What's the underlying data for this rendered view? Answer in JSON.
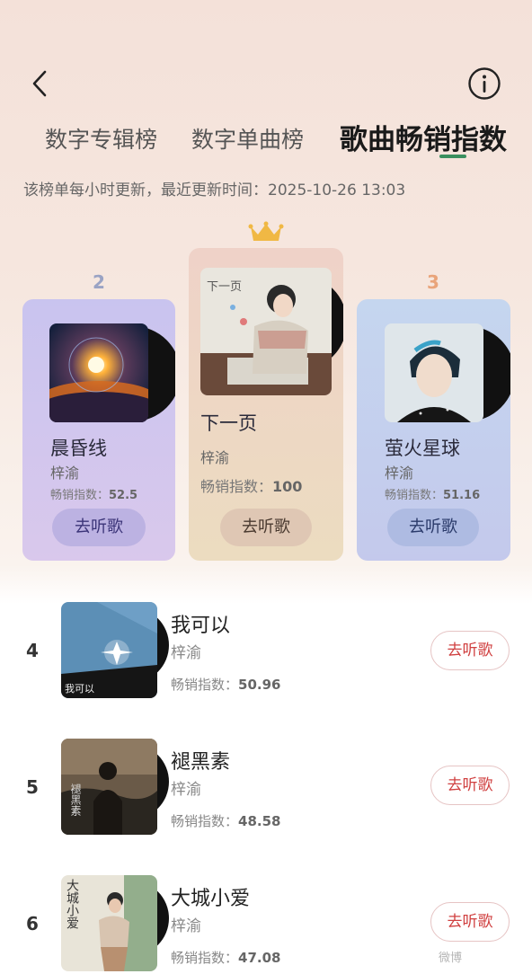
{
  "header": {
    "tabs": [
      "数字专辑榜",
      "数字单曲榜",
      "歌曲畅销指数"
    ],
    "active_tab": "歌曲畅销指数",
    "update_note": "该榜单每小时更新，最近更新时间：2025-10-26 13:03",
    "back_icon": "chevron-left-icon",
    "info_icon": "info-circle-icon"
  },
  "podium": {
    "crown_icon": "crown-icon",
    "first": {
      "rank": "1",
      "title": "下一页",
      "artist": "梓渝",
      "index_label": "畅销指数：",
      "index_value": "100",
      "button": "去听歌"
    },
    "second": {
      "rank": "2",
      "title": "晨昏线",
      "artist": "梓渝",
      "index_label": "畅销指数：",
      "index_value": "52.5",
      "button": "去听歌"
    },
    "third": {
      "rank": "3",
      "title": "萤火星球",
      "artist": "梓渝",
      "index_label": "畅销指数：",
      "index_value": "51.16",
      "button": "去听歌"
    }
  },
  "list": [
    {
      "rank": "4",
      "title": "我可以",
      "artist": "梓渝",
      "index_label": "畅销指数：",
      "index_value": "50.96",
      "button": "去听歌"
    },
    {
      "rank": "5",
      "title": "褪黑素",
      "artist": "梓渝",
      "index_label": "畅销指数：",
      "index_value": "48.58",
      "button": "去听歌"
    },
    {
      "rank": "6",
      "title": "大城小爱",
      "artist": "梓渝",
      "index_label": "畅销指数：",
      "index_value": "47.08",
      "button": "去听歌"
    }
  ],
  "cover_texts": {
    "first": "下一页",
    "list_4": "我可以",
    "list_5": "褪黑素",
    "list_6": "大城小爱"
  },
  "colors": {
    "accent_green": "#3a8f5f",
    "button_red": "#d04040",
    "rank2": "#9aa3c4",
    "rank3": "#e9a47a",
    "crown": "#f0b844"
  },
  "watermark": "微博"
}
